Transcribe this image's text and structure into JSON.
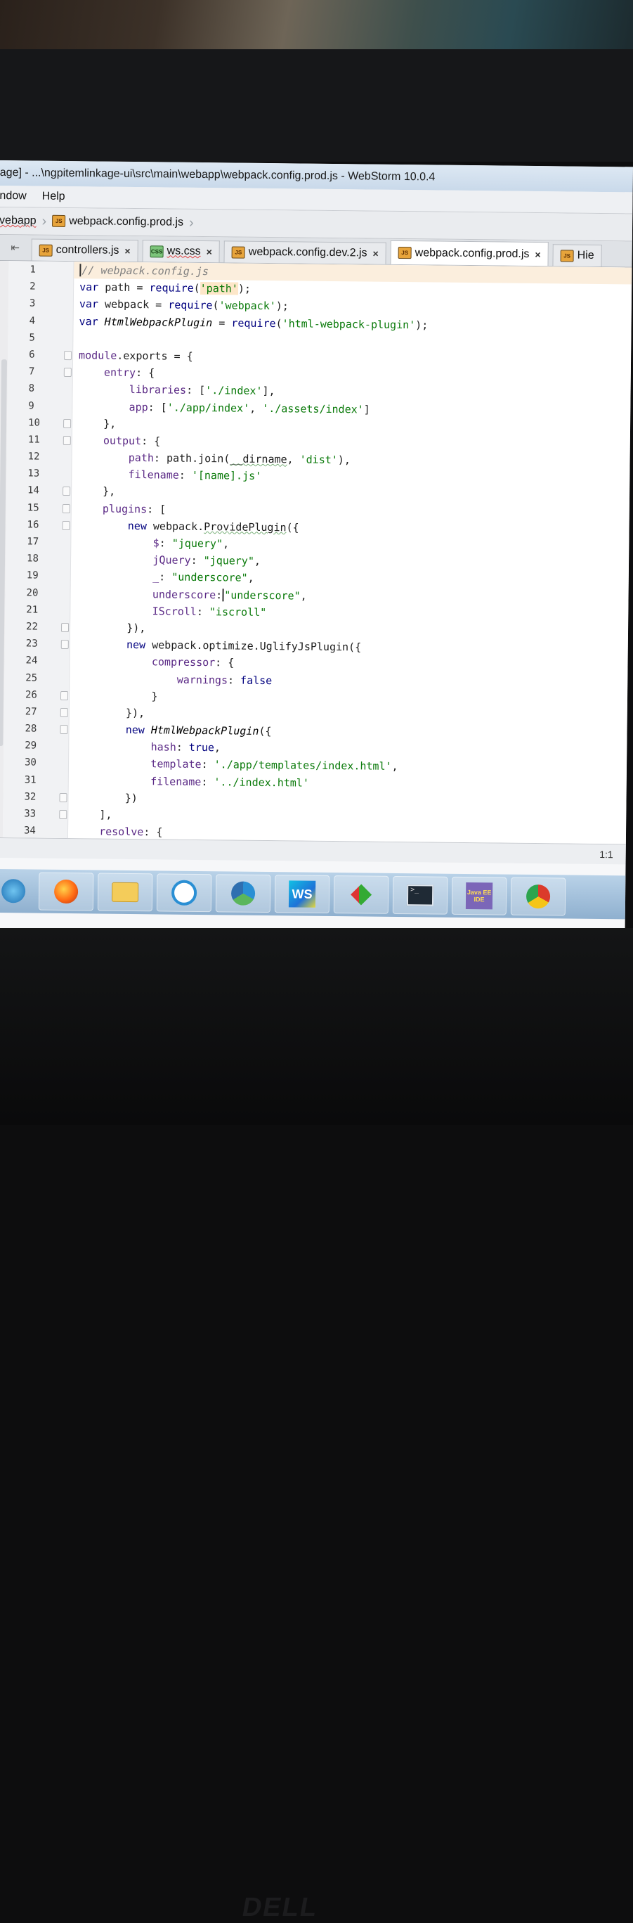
{
  "window": {
    "title": "age] - ...\\ngpitemlinkage-ui\\src\\main\\webapp\\webpack.config.prod.js - WebStorm 10.0.4"
  },
  "menu": {
    "items": [
      "ndow",
      "Help"
    ]
  },
  "breadcrumb": {
    "root": "vebapp",
    "file": "webpack.config.prod.js"
  },
  "tabs": [
    {
      "label": "controllers.js",
      "icon": "js-file-icon"
    },
    {
      "label": "ws.css",
      "icon": "css-file-icon"
    },
    {
      "label": "webpack.config.dev.2.js",
      "icon": "js-file-icon"
    },
    {
      "label": "webpack.config.prod.js",
      "icon": "js-file-icon",
      "active": true
    },
    {
      "label": "Hie",
      "icon": "js-file-icon"
    }
  ],
  "editor": {
    "line_numbers": [
      "1",
      "2",
      "3",
      "4",
      "5",
      "6",
      "7",
      "8",
      "9",
      "10",
      "11",
      "12",
      "13",
      "14",
      "15",
      "16",
      "17",
      "18",
      "19",
      "20",
      "21",
      "22",
      "23",
      "24",
      "25",
      "26",
      "27",
      "28",
      "29",
      "30",
      "31",
      "32",
      "33",
      "34"
    ],
    "lines": [
      "// webpack.config.js",
      "var path = require('path');",
      "var webpack = require('webpack');",
      "var HtmlWebpackPlugin = require('html-webpack-plugin');",
      "",
      "module.exports = {",
      "    entry: {",
      "        libraries: ['./index'],",
      "        app: ['./app/index', './assets/index']",
      "    },",
      "    output: {",
      "        path: path.join(__dirname, 'dist'),",
      "        filename: '[name].js'",
      "    },",
      "    plugins: [",
      "        new webpack.ProvidePlugin({",
      "            $: \"jquery\",",
      "            jQuery: \"jquery\",",
      "            _: \"underscore\",",
      "            underscore: \"underscore\",",
      "            IScroll: \"iscroll\"",
      "        }),",
      "        new webpack.optimize.UglifyJsPlugin({",
      "            compressor: {",
      "                warnings: false",
      "            }",
      "        }),",
      "        new HtmlWebpackPlugin({",
      "            hash: true,",
      "            template: './app/templates/index.html',",
      "            filename: '../index.html'",
      "        })",
      "    ],",
      "    resolve: {"
    ]
  },
  "status": {
    "position": "1:1"
  },
  "taskbar": {
    "apps": [
      "windows-start-icon",
      "firefox-icon",
      "folder-icon",
      "chat-icon",
      "chrome-remote-icon",
      "webstorm-icon",
      "git-icon",
      "terminal-icon",
      "java-ee-ide-icon",
      "chrome-icon"
    ],
    "java_label": "Java EE IDE"
  },
  "hardware": {
    "brand": "DELL"
  },
  "colors": {
    "accent": "#00007f",
    "string": "#0a7a0a",
    "current_line": "#fbeedd"
  }
}
